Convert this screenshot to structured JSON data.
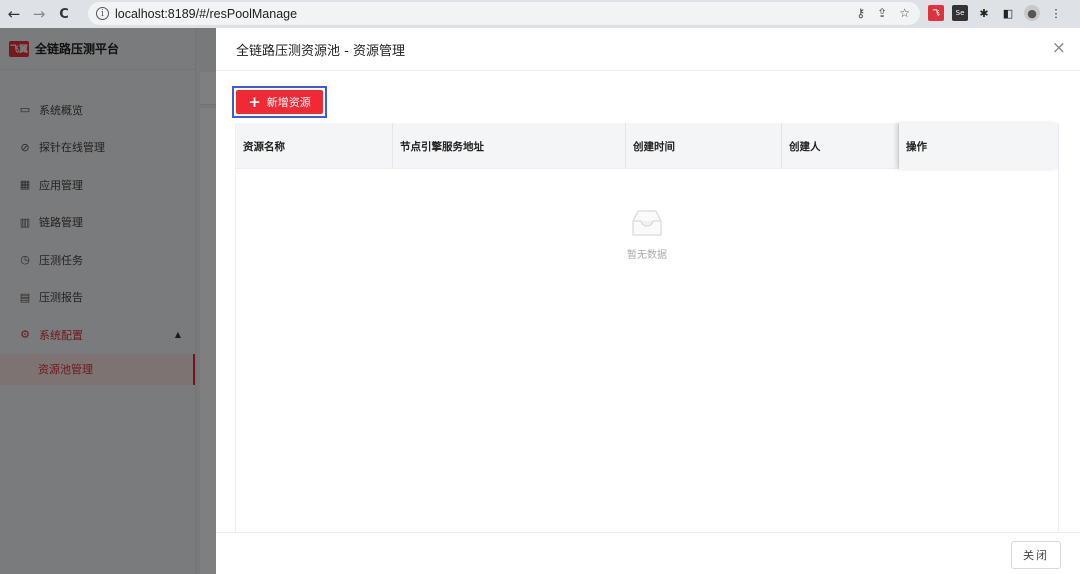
{
  "browser": {
    "url": "localhost:8189/#/resPoolManage",
    "back_icon": "←",
    "forward_icon": "→",
    "reload_icon": "C",
    "info_icon": "i"
  },
  "sidebar": {
    "logo_text": "飞翼",
    "app_name": "全链路压测平台",
    "items": [
      {
        "icon": "▭",
        "label": "系统概览"
      },
      {
        "icon": "⊘",
        "label": "探针在线管理"
      },
      {
        "icon": "▦",
        "label": "应用管理"
      },
      {
        "icon": "▥",
        "label": "链路管理"
      },
      {
        "icon": "◷",
        "label": "压测任务"
      },
      {
        "icon": "▤",
        "label": "压测报告"
      },
      {
        "icon": "⚙",
        "label": "系统配置",
        "expanded": true
      }
    ],
    "sub_items": [
      {
        "label": "资源池管理",
        "active": true
      }
    ],
    "accent": "#e0323a"
  },
  "drawer": {
    "title": "全链路压测资源池 - 资源管理",
    "add_button": "新增资源",
    "add_icon": "+",
    "close_icon": "×",
    "columns": [
      "资源名称",
      "节点引擎服务地址",
      "创建时间",
      "创建人",
      "操作"
    ],
    "rows": [],
    "empty_text": "暂无数据",
    "close_button": "关闭"
  }
}
